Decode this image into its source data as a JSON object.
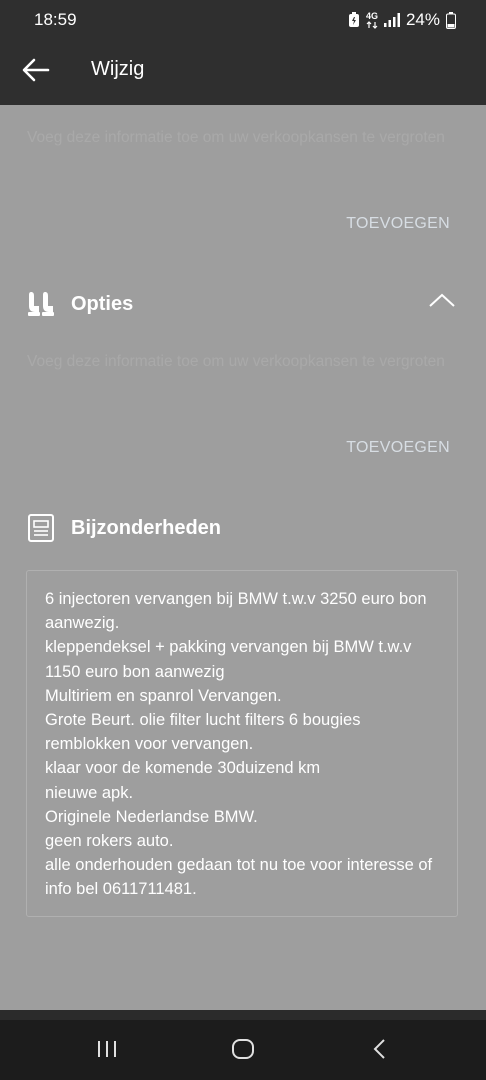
{
  "status_bar": {
    "time": "18:59",
    "network": "4G",
    "battery": "24%",
    "icons": [
      "battery-saver-icon",
      "network-4g-icon",
      "signal-icon",
      "battery-icon"
    ]
  },
  "app_bar": {
    "title": "Wijzig",
    "back_icon": "back-arrow-icon"
  },
  "sections": {
    "previous": {
      "hint": "Voeg deze informatie toe om uw verkoopkansen te vergroten",
      "add_label": "TOEVOEGEN"
    },
    "options": {
      "title": "Opties",
      "icon": "seat-icon",
      "collapse_icon": "chevron-up-icon",
      "hint": "Voeg deze informatie toe om uw verkoopkansen te vergroten",
      "add_label": "TOEVOEGEN"
    },
    "details": {
      "title": "Bijzonderheden",
      "icon": "document-icon",
      "text": "6 injectoren vervangen bij BMW t.w.v 3250 euro bon aanwezig.\nkleppendeksel + pakking vervangen bij BMW t.w.v 1150 euro bon aanwezig\nMultiriem en spanrol Vervangen.\nGrote Beurt. olie filter lucht filters 6 bougies remblokken voor vervangen.\nklaar voor de komende 30duizend km\nnieuwe apk.\nOriginele Nederlandse BMW.\ngeen rokers auto.\nalle onderhouden gedaan tot nu toe voor interesse of info bel 0611711481."
    }
  },
  "nav_bar": {
    "icons": [
      "recent-apps-icon",
      "home-icon",
      "back-icon"
    ]
  },
  "colors": {
    "overlay_background": "#9e9e9e",
    "app_bar": "#2f2f2f",
    "nav_bar": "#1c1c1c"
  }
}
